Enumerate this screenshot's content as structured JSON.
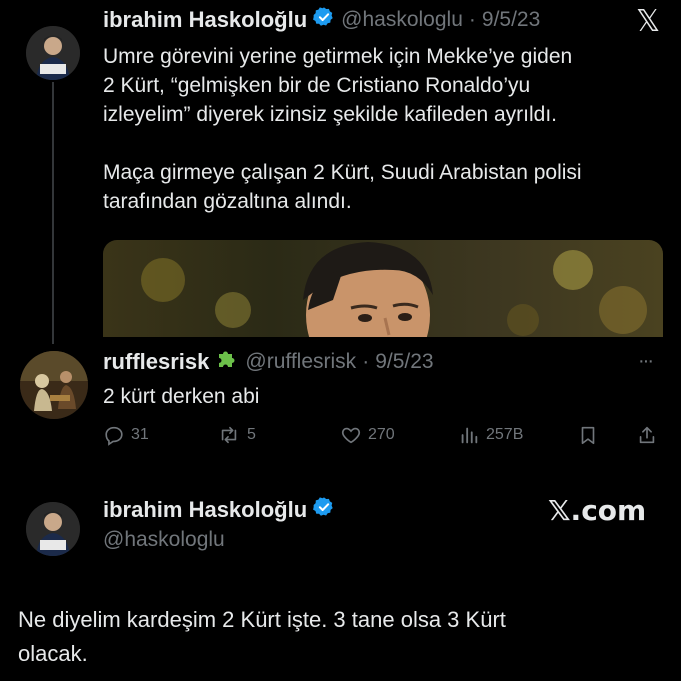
{
  "tweet1": {
    "name": "ibrahim Haskoloğlu",
    "handle": "@haskologlu",
    "separator": "·",
    "date": "9/5/23",
    "line1": "Umre görevini yerine getirmek için Mekke’ye giden",
    "line2": "2 Kürt, “gelmişken bir de Cristiano Ronaldo’yu",
    "line3": "izleyelim” diyerek izinsiz şekilde kafileden ayrıldı.",
    "line4": "Maça girmeye çalışan 2 Kürt, Suudi Arabistan polisi",
    "line5": "tarafından gözaltına alındı."
  },
  "x_logo_text": "𝕏",
  "reply": {
    "name": "rufflesrisk",
    "handle": "@rufflesrisk",
    "separator": "·",
    "date": "9/5/23",
    "text": "2 kürt derken abi",
    "more": "···",
    "actions": {
      "replies": "31",
      "retweets": "5",
      "likes": "270",
      "views": "257B"
    }
  },
  "footer": {
    "name": "ibrahim Haskoloğlu",
    "handle": "@haskologlu",
    "brand": "𝕏.com",
    "line1": "Ne diyelim kardeşim 2 Kürt işte. 3 tane olsa 3 Kürt",
    "line2": "olacak."
  },
  "colors": {
    "background": "#000000",
    "text": "#e7e9ea",
    "muted": "#71767b",
    "verified": "#1d9bf0",
    "puzzle": "#6cc04a"
  }
}
